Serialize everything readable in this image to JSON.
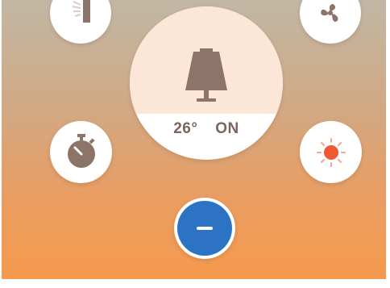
{
  "status": {
    "temperature": "26°",
    "power_state": "ON"
  },
  "controls": {
    "top_left_icon": "curtain-icon",
    "top_right_icon": "fan-icon",
    "center_icon": "lamp-icon",
    "timer_icon": "timer-icon",
    "brightness_icon": "sun-icon",
    "minus_icon": "minus-icon"
  },
  "colors": {
    "accent_blue": "#2d73c4",
    "icon_brown": "#8c7468",
    "sun_orange": "#f05a33",
    "dial_tint": "#fbe6d8"
  }
}
